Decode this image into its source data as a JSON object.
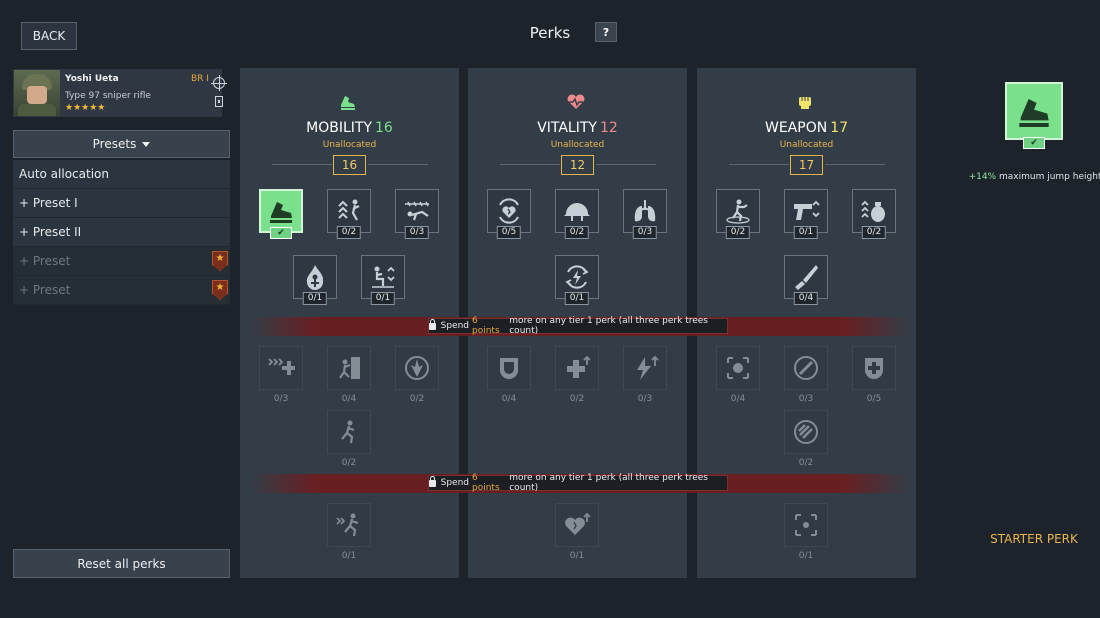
{
  "header": {
    "back_label": "BACK",
    "title": "Perks",
    "help_label": "?"
  },
  "soldier": {
    "name": "Yoshi Ueta",
    "weapon": "Type 97 sniper rifle",
    "stars": "★★★★★",
    "br": "BR I"
  },
  "presets": {
    "button_label": "Presets",
    "items": [
      {
        "label": "Auto allocation",
        "locked": false
      },
      {
        "label": "+ Preset I",
        "locked": false
      },
      {
        "label": "+ Preset II",
        "locked": false
      },
      {
        "label": "+ Preset",
        "locked": true
      },
      {
        "label": "+ Preset",
        "locked": true
      }
    ],
    "lock_glyph": "★"
  },
  "reset_label": "Reset all perks",
  "columns": [
    {
      "name": "MOBILITY",
      "points": "16",
      "unallocated_label": "Unallocated",
      "unallocated": "16",
      "accent": "#7ae08c",
      "icon": "boot-icon",
      "tier1_row1": [
        "✔",
        "0/2",
        "0/3"
      ],
      "tier1_row2": [
        "0/1",
        "0/1"
      ],
      "tier2_row1": [
        "0/3",
        "0/4",
        "0/2"
      ],
      "tier2_row2": [
        "0/2"
      ],
      "tier3": [
        "0/1"
      ]
    },
    {
      "name": "VITALITY",
      "points": "12",
      "unallocated_label": "Unallocated",
      "unallocated": "12",
      "accent": "#f08a8a",
      "icon": "heartbeat-icon",
      "tier1_row1": [
        "0/5",
        "0/2",
        "0/3"
      ],
      "tier1_row2": [
        "0/1"
      ],
      "tier2_row1": [
        "0/4",
        "0/2",
        "0/3"
      ],
      "tier3": [
        "0/1"
      ]
    },
    {
      "name": "WEAPON",
      "points": "17",
      "unallocated_label": "Unallocated",
      "unallocated": "17",
      "accent": "#f2e36a",
      "icon": "fist-icon",
      "tier1_row1": [
        "0/2",
        "0/1",
        "0/2"
      ],
      "tier1_row2": [
        "0/4"
      ],
      "tier2_row1": [
        "0/4",
        "0/3",
        "0/5"
      ],
      "tier2_row2": [
        "0/2"
      ],
      "tier3": [
        "0/1"
      ]
    }
  ],
  "tier_lock": {
    "prefix": "Spend",
    "points": "6 points",
    "suffix": "more on any tier 1 perk (all three perk trees count)"
  },
  "detail": {
    "check": "✔",
    "value": "+14%",
    "description": "maximum jump height",
    "starter_label": "STARTER PERK"
  }
}
